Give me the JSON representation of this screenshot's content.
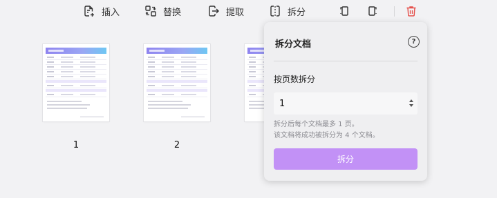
{
  "toolbar": {
    "insert_label": "插入",
    "replace_label": "替换",
    "extract_label": "提取",
    "split_label": "拆分",
    "icons": [
      "insert-icon",
      "replace-icon",
      "extract-icon",
      "split-icon",
      "rotate-left-icon",
      "rotate-right-icon",
      "trash-icon"
    ],
    "delete_color": "#e5504b"
  },
  "pages": [
    {
      "number": "1"
    },
    {
      "number": "2"
    }
  ],
  "split_panel": {
    "title": "拆分文档",
    "help_glyph": "?",
    "mode_label": "按页数拆分",
    "pages_value": "1",
    "hint_line1": "拆分后每个文档最多 1 页。",
    "hint_line2": "该文档将成功被拆分为 4 个文档。",
    "button_label": "拆分",
    "button_color": "#c291f6"
  }
}
